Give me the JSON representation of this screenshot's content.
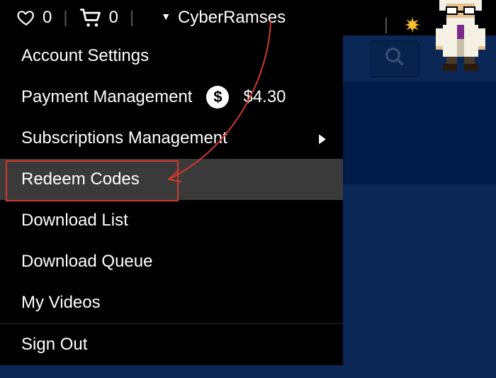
{
  "topbar": {
    "wishlist_count": "0",
    "cart_count": "0",
    "username": "CyberRamses",
    "separator": "|"
  },
  "menu": {
    "items": [
      {
        "label": "Account Settings",
        "has_chevron": false,
        "has_balance": false
      },
      {
        "label": "Payment Management",
        "has_chevron": false,
        "has_balance": true,
        "balance": "$4.30"
      },
      {
        "label": "Subscriptions Management",
        "has_chevron": true,
        "has_balance": false
      },
      {
        "label": "Redeem Codes",
        "has_chevron": false,
        "has_balance": false,
        "highlighted": true
      },
      {
        "label": "Download List",
        "has_chevron": false,
        "has_balance": false
      },
      {
        "label": "Download Queue",
        "has_chevron": false,
        "has_balance": false
      },
      {
        "label": "My Videos",
        "has_chevron": false,
        "has_balance": false
      },
      {
        "label": "Sign Out",
        "has_chevron": false,
        "has_balance": false,
        "separated": true
      }
    ]
  },
  "annotation": {
    "target_label": "Redeem Codes"
  },
  "colors": {
    "bg_dark": "#000000",
    "bg_navy": "#0a2756",
    "bg_navy_deep": "#001b49",
    "highlight": "#d13a2a",
    "menu_hover": "#3a3a3a"
  }
}
